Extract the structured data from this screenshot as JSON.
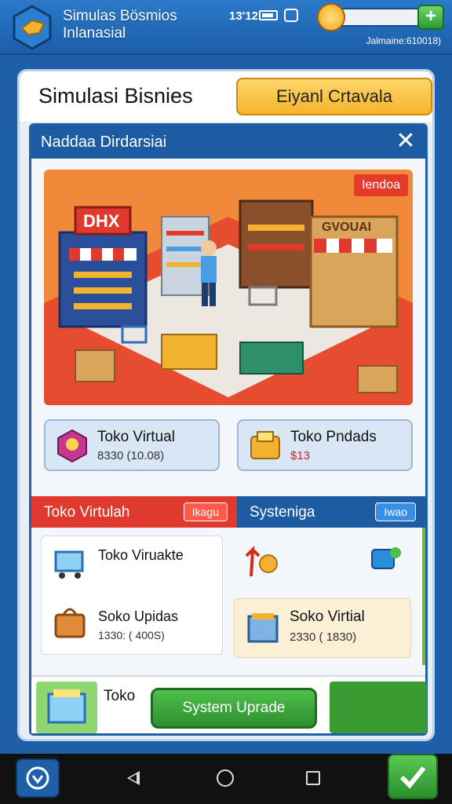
{
  "status": {
    "app_title_line1": "Simulas Bösmios",
    "app_title_line2": "Inlanasial",
    "clock": "13'12",
    "coin_sub_label": "Jalmaine:610018)",
    "coin_fill_fraction": 0.1
  },
  "header": {
    "title": "Simulasi Bisnies",
    "action_button": "Eiyanl Crtavala"
  },
  "dialog": {
    "title": "Naddaa Dirdarsiai",
    "close_icon": "close-icon",
    "scene_badge": "Iendoa",
    "scene_sign_left": "DHX",
    "scene_sign_right": "GVOUAI"
  },
  "products": [
    {
      "name": "Toko Virtual",
      "price": "8330 (10.08)",
      "icon": "store-tag-icon"
    },
    {
      "name": "Toko Pndads",
      "price": "$13",
      "icon": "cash-register-icon"
    }
  ],
  "tabs": {
    "left": {
      "label": "Toko Virtulah",
      "pill": "Ikagu"
    },
    "right": {
      "label": "Systeniga",
      "pill": "Iwao"
    }
  },
  "left_pane": [
    {
      "title": "Toko Viruakte",
      "price": "",
      "icon": "shopping-cart-icon"
    },
    {
      "title": "Soko Upidas",
      "price": "1330: ( 400S)",
      "icon": "shopping-bag-icon"
    }
  ],
  "right_pane": {
    "card_title": "Soko Virtial",
    "card_price": "2330 ( 1830)",
    "icons": [
      "upgrade-arrow-icon",
      "chat-bubble-icon",
      "building-icon"
    ]
  },
  "action_row": {
    "label": "Toko",
    "button": "System Uprade"
  },
  "colors": {
    "primary": "#1f5fa8",
    "accent_red": "#e0392d",
    "accent_yellow": "#f4b52b",
    "accent_green": "#2e8f2f"
  }
}
